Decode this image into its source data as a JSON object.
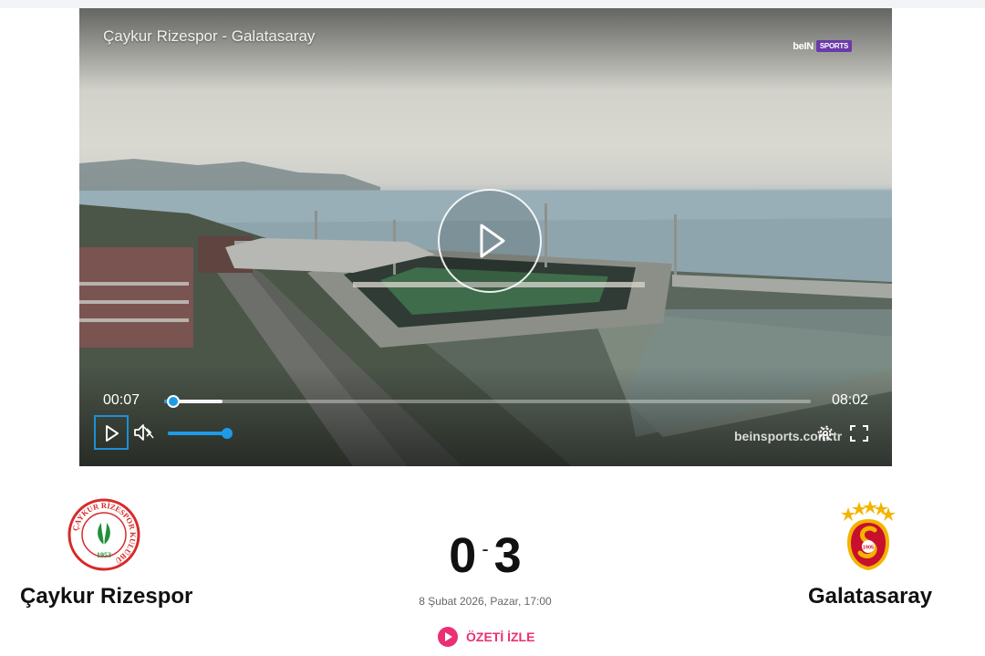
{
  "player": {
    "title": "Çaykur Rizespor - Galatasaray",
    "brand_logo": {
      "bein": "beIN",
      "sports": "SPORTS"
    },
    "current_time": "00:07",
    "duration": "08:02",
    "progress_fraction": 0.0145,
    "buffered_fraction": 0.09,
    "volume_fraction": 1.0,
    "watermark": "beinsports.com.tr",
    "icons": [
      "play-icon",
      "mute-icon",
      "settings-icon",
      "fullscreen-icon"
    ]
  },
  "match": {
    "home_team": "Çaykur Rizespor",
    "away_team": "Galatasaray",
    "home_score": "0",
    "separator": "-",
    "away_score": "3",
    "date": "8 Şubat 2026, Pazar, 17:00",
    "highlights_label": "ÖZETİ İZLE"
  },
  "crests": {
    "home_ring_text": "ÇAYKUR RİZESPOR KULÜBÜ",
    "home_year": "1953",
    "away_year": "1905"
  },
  "colors": {
    "accent_blue": "#1e9be6",
    "highlight_pink": "#ea2f74",
    "home_red": "#d72a2a",
    "home_green": "#1f8f3a",
    "away_yellow": "#f3b400",
    "away_red": "#c8102e"
  }
}
